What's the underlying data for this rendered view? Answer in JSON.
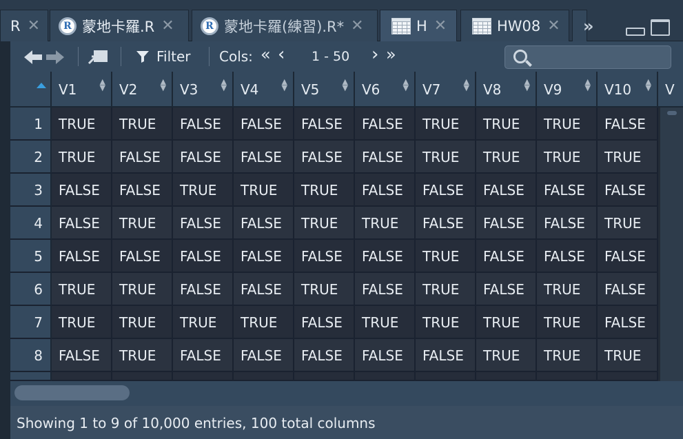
{
  "tabs": [
    {
      "label": "R",
      "close": "✕",
      "icon": "none",
      "active": false
    },
    {
      "label": "蒙地卡羅.R",
      "close": "✕",
      "icon": "r-script-icon",
      "active": false
    },
    {
      "label": "蒙地卡羅(練習).R*",
      "close": "✕",
      "icon": "r-script-icon",
      "active": false
    },
    {
      "label": "H",
      "close": "✕",
      "icon": "data-grid-icon",
      "active": true
    },
    {
      "label": "HW08",
      "close": "✕",
      "icon": "data-grid-icon",
      "active": false
    }
  ],
  "toolbar": {
    "filter_label": "Filter",
    "cols_label": "Cols:",
    "first_cols": "«",
    "prev_cols": "‹",
    "cols_range": "1 - 50",
    "next_cols": "›",
    "last_cols": "»",
    "search_placeholder": ""
  },
  "table": {
    "columns": [
      "V1",
      "V2",
      "V3",
      "V4",
      "V5",
      "V6",
      "V7",
      "V8",
      "V9",
      "V10",
      "V"
    ],
    "rows": [
      {
        "n": "1",
        "cells": [
          "TRUE",
          "TRUE",
          "FALSE",
          "FALSE",
          "FALSE",
          "FALSE",
          "TRUE",
          "TRUE",
          "TRUE",
          "FALSE"
        ]
      },
      {
        "n": "2",
        "cells": [
          "TRUE",
          "FALSE",
          "FALSE",
          "FALSE",
          "FALSE",
          "FALSE",
          "TRUE",
          "TRUE",
          "TRUE",
          "TRUE"
        ]
      },
      {
        "n": "3",
        "cells": [
          "FALSE",
          "FALSE",
          "TRUE",
          "TRUE",
          "TRUE",
          "FALSE",
          "FALSE",
          "FALSE",
          "FALSE",
          "FALSE"
        ]
      },
      {
        "n": "4",
        "cells": [
          "FALSE",
          "TRUE",
          "FALSE",
          "FALSE",
          "TRUE",
          "TRUE",
          "FALSE",
          "FALSE",
          "FALSE",
          "TRUE"
        ]
      },
      {
        "n": "5",
        "cells": [
          "FALSE",
          "FALSE",
          "FALSE",
          "FALSE",
          "FALSE",
          "FALSE",
          "TRUE",
          "FALSE",
          "FALSE",
          "FALSE"
        ]
      },
      {
        "n": "6",
        "cells": [
          "TRUE",
          "TRUE",
          "FALSE",
          "FALSE",
          "TRUE",
          "FALSE",
          "TRUE",
          "FALSE",
          "TRUE",
          "FALSE"
        ]
      },
      {
        "n": "7",
        "cells": [
          "TRUE",
          "TRUE",
          "TRUE",
          "TRUE",
          "FALSE",
          "TRUE",
          "TRUE",
          "TRUE",
          "TRUE",
          "FALSE"
        ]
      },
      {
        "n": "8",
        "cells": [
          "FALSE",
          "TRUE",
          "FALSE",
          "FALSE",
          "FALSE",
          "FALSE",
          "FALSE",
          "TRUE",
          "TRUE",
          "TRUE"
        ]
      }
    ]
  },
  "status": {
    "text": "Showing 1 to 9 of 10,000 entries, 100 total columns"
  },
  "colors": {
    "sort_indicator": "#3a9fe0",
    "panel": "#34495e",
    "cell": "#262d3a"
  }
}
